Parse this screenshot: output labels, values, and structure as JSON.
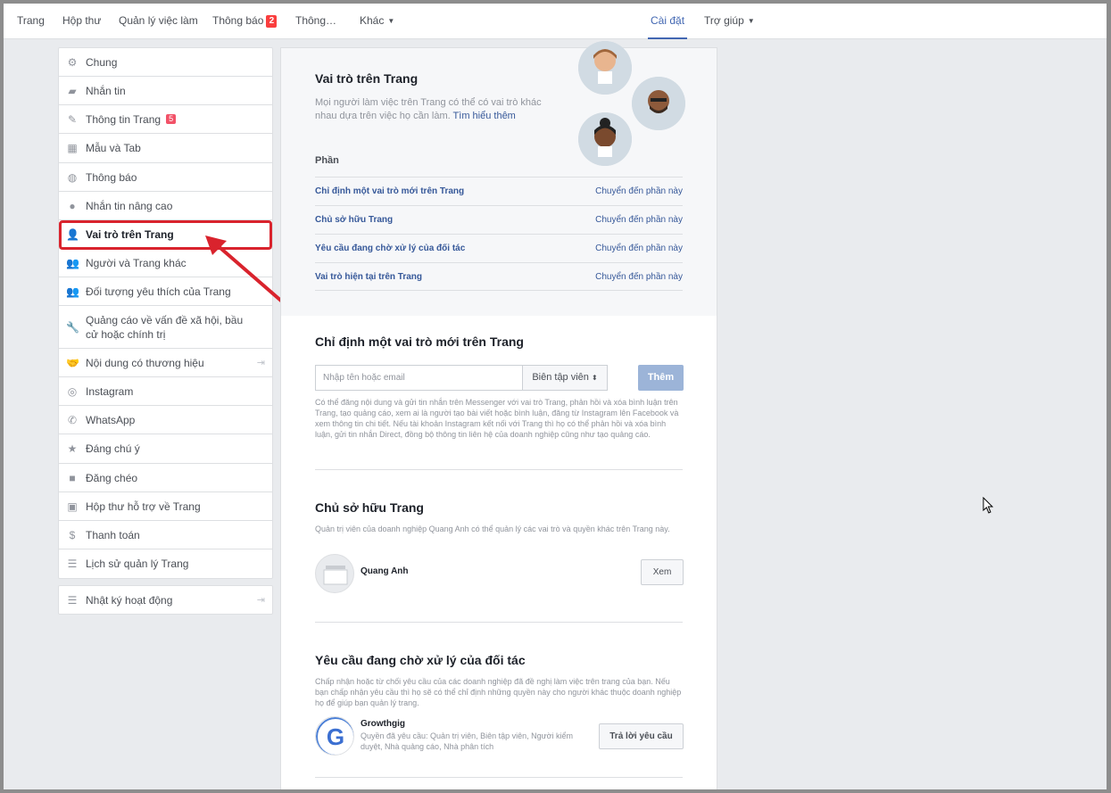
{
  "topnav": {
    "items": [
      "Trang",
      "Hộp thư",
      "Quản lý việc làm",
      "Thông báo",
      "Thông…",
      "Khác"
    ],
    "notification_badge": "2",
    "settings": "Cài đặt",
    "help": "Trợ giúp"
  },
  "sidebar": {
    "items": [
      {
        "label": "Chung",
        "icon": "gear-icon"
      },
      {
        "label": "Nhắn tin",
        "icon": "chat-icon"
      },
      {
        "label": "Thông tin Trang",
        "icon": "pencil-icon",
        "badge": "5"
      },
      {
        "label": "Mẫu và Tab",
        "icon": "grid-icon"
      },
      {
        "label": "Thông báo",
        "icon": "globe-icon"
      },
      {
        "label": "Nhắn tin nâng cao",
        "icon": "messenger-icon"
      },
      {
        "label": "Vai trò trên Trang",
        "icon": "person-icon",
        "active": true
      },
      {
        "label": "Người và Trang khác",
        "icon": "people-icon"
      },
      {
        "label": "Đối tượng yêu thích của Trang",
        "icon": "people-icon"
      },
      {
        "label": "Quảng cáo về vấn đề xã hội, bầu cử hoặc chính trị",
        "icon": "wrench-icon"
      },
      {
        "label": "Nội dung có thương hiệu",
        "icon": "handshake-icon"
      },
      {
        "label": "Instagram",
        "icon": "instagram-icon"
      },
      {
        "label": "WhatsApp",
        "icon": "whatsapp-icon"
      },
      {
        "label": "Đáng chú ý",
        "icon": "star-icon"
      },
      {
        "label": "Đăng chéo",
        "icon": "video-icon"
      },
      {
        "label": "Hộp thư hỗ trợ về Trang",
        "icon": "facebook-icon"
      },
      {
        "label": "Thanh toán",
        "icon": "dollar-icon"
      },
      {
        "label": "Lịch sử quản lý Trang",
        "icon": "history-icon"
      }
    ],
    "activity_log": "Nhật ký hoạt động"
  },
  "hero": {
    "title": "Vai trò trên Trang",
    "desc": "Mọi người làm việc trên Trang có thể có vai trò khác nhau dựa trên việc họ cần làm.",
    "learn_more": "Tìm hiểu thêm",
    "sections_label": "Phần",
    "sections": [
      "Chỉ định một vai trò mới trên Trang",
      "Chủ sở hữu Trang",
      "Yêu cầu đang chờ xử lý của đối tác",
      "Vai trò hiện tại trên Trang"
    ],
    "jump_label": "Chuyển đến phần này"
  },
  "assign": {
    "title": "Chỉ định một vai trò mới trên Trang",
    "placeholder": "Nhập tên hoặc email",
    "role": "Biên tập viên",
    "add_button": "Thêm",
    "desc": "Có thể đăng nội dung và gửi tin nhắn trên Messenger với vai trò Trang, phản hồi và xóa bình luận trên Trang, tạo quảng cáo, xem ai là người tạo bài viết hoặc bình luận, đăng từ Instagram lên Facebook và xem thông tin chi tiết. Nếu tài khoản Instagram kết nối với Trang thì họ có thể phản hồi và xóa bình luận, gửi tin nhắn Direct, đồng bộ thông tin liên hệ của doanh nghiệp cũng như tạo quảng cáo."
  },
  "owner": {
    "title": "Chủ sở hữu Trang",
    "desc": "Quản trị viên của doanh nghiệp Quang Anh có thể quản lý các vai trò và quyền khác trên Trang này.",
    "name": "Quang Anh",
    "view_button": "Xem"
  },
  "pending": {
    "title": "Yêu cầu đang chờ xử lý của đối tác",
    "desc": "Chấp nhận hoặc từ chối yêu cầu của các doanh nghiệp đã đề nghị làm việc trên trang của bạn. Nếu bạn chấp nhận yêu cầu thì họ sẽ có thể chỉ định những quyền này cho người khác thuộc doanh nghiệp họ để giúp bạn quản lý trang.",
    "partner_name": "Growthgig",
    "partner_perms": "Quyền đã yêu cầu: Quản trị viên, Biên tập viên, Người kiểm duyệt, Nhà quảng cáo, Nhà phân tích",
    "reply_button": "Trả lời yêu cầu"
  },
  "colors": {
    "accent": "#4267b2",
    "highlight": "#d9232d",
    "background": "#e9ebee"
  }
}
